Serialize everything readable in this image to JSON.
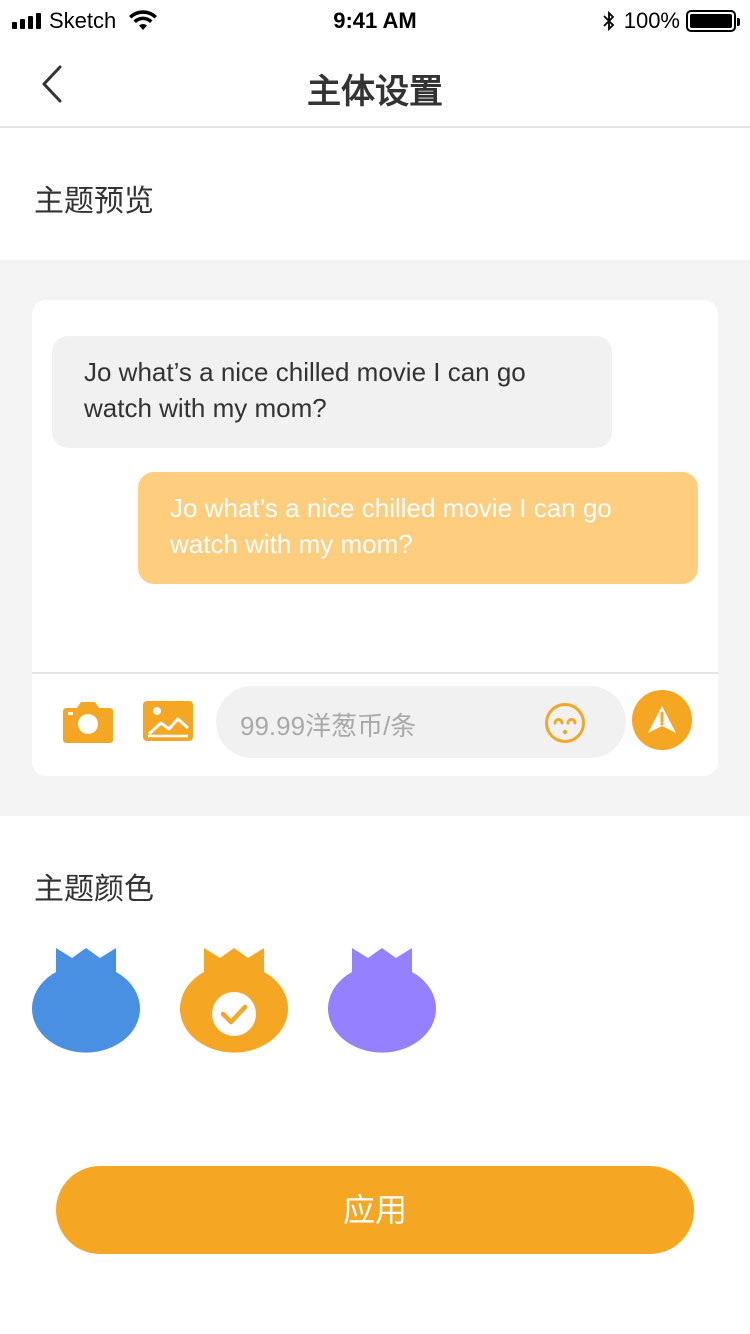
{
  "status_bar": {
    "carrier": "Sketch",
    "time": "9:41 AM",
    "battery_percent": "100%"
  },
  "nav": {
    "title": "主体设置",
    "back_icon": "chevron-left-icon"
  },
  "preview": {
    "heading": "主题预览",
    "incoming_message": "Jo what’s a nice chilled movie I can go watch with my mom?",
    "outgoing_message": "Jo what’s a nice chilled movie I can go watch with my mom?",
    "input_placeholder": "99.99洋葱币/条",
    "icons": [
      "camera-icon",
      "image-icon",
      "emoji-icon",
      "send-icon"
    ]
  },
  "theme_colors": {
    "heading": "主题颜色",
    "options": [
      {
        "name": "blue",
        "color": "#4a90e2",
        "selected": false
      },
      {
        "name": "orange",
        "color": "#f5a623",
        "selected": true
      },
      {
        "name": "purple",
        "color": "#9580ff",
        "selected": false
      }
    ]
  },
  "apply_button": {
    "label": "应用"
  },
  "colors": {
    "accent": "#f5a623",
    "outgoing_bubble": "#fecd7e",
    "incoming_bubble": "#f1f1f1",
    "background_gray": "#f4f4f4"
  }
}
